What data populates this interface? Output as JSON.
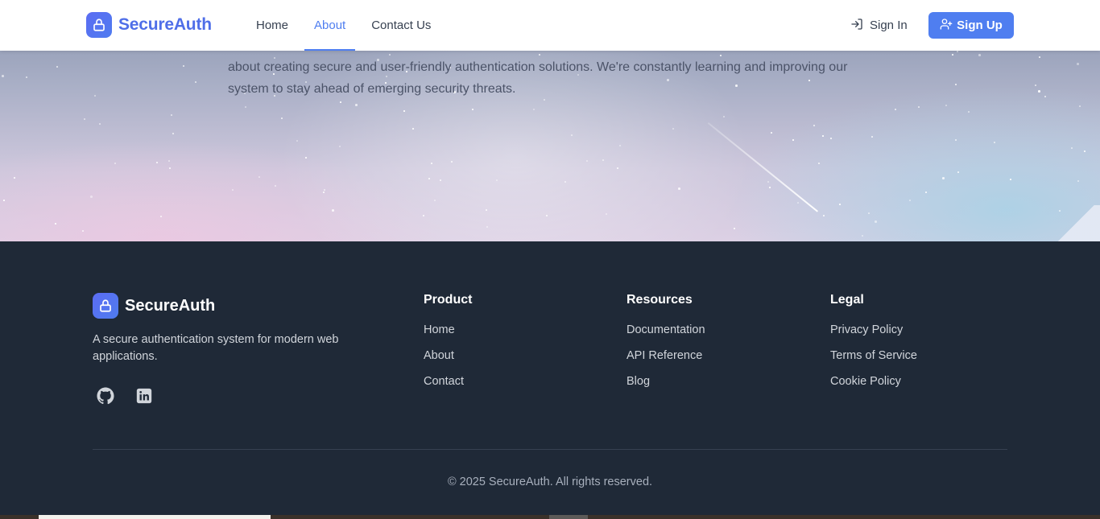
{
  "header": {
    "brand": "SecureAuth",
    "nav": [
      {
        "label": "Home",
        "active": false
      },
      {
        "label": "About",
        "active": true
      },
      {
        "label": "Contact Us",
        "active": false
      }
    ],
    "sign_in": "Sign In",
    "sign_up": "Sign Up"
  },
  "hero": {
    "text": "about creating secure and user-friendly authentication solutions. We're constantly learning and improving our system to stay ahead of emerging security threats."
  },
  "footer": {
    "brand": "SecureAuth",
    "description": "A secure authentication system for modern web applications.",
    "social": [
      {
        "icon": "github-icon"
      },
      {
        "icon": "linkedin-icon"
      }
    ],
    "columns": [
      {
        "title": "Product",
        "links": [
          "Home",
          "About",
          "Contact"
        ]
      },
      {
        "title": "Resources",
        "links": [
          "Documentation",
          "API Reference",
          "Blog"
        ]
      },
      {
        "title": "Legal",
        "links": [
          "Privacy Policy",
          "Terms of Service",
          "Cookie Policy"
        ]
      }
    ],
    "copyright": "© 2025 SecureAuth. All rights reserved."
  },
  "colors": {
    "accent": "#4f7ef0",
    "footer_bg": "#1f2937",
    "header_bg": "#ffffff"
  }
}
